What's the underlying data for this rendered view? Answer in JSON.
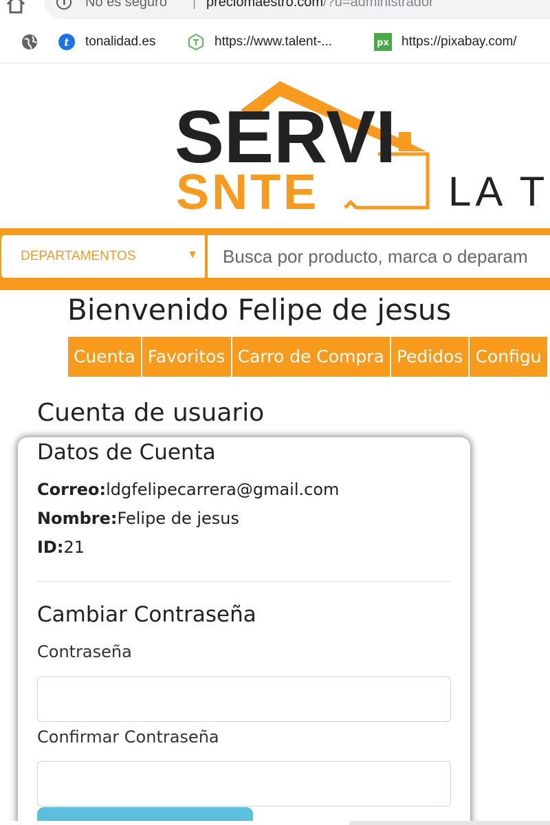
{
  "browser": {
    "security_label": "No es seguro",
    "url_host": "preciomaestro.com",
    "url_path": "/?u=administrador",
    "bookmarks": [
      {
        "label": "tonalidad.es",
        "icon": "tonalidad-favicon"
      },
      {
        "label": "https://www.talent-...",
        "icon": "talent-favicon"
      },
      {
        "label": "https://pixabay.com/",
        "icon": "pixabay-favicon"
      }
    ]
  },
  "header": {
    "logo_text_top": "SERVI",
    "logo_text_bottom": "SNTE",
    "tagline": "LA T",
    "departments_label": "DEPARTAMENTOS",
    "search_placeholder": "Busca por producto, marca o deparam",
    "colors": {
      "accent": "#f89a1c",
      "button": "#5bc0de"
    }
  },
  "welcome": "Bienvenido Felipe de jesus",
  "tabs": [
    {
      "label": "Cuenta"
    },
    {
      "label": "Favoritos"
    },
    {
      "label": "Carro de Compra"
    },
    {
      "label": "Pedidos"
    },
    {
      "label": "Configu"
    }
  ],
  "account": {
    "section_title": "Cuenta de usuario",
    "card_title": "Datos de Cuenta",
    "email_label": "Correo:",
    "email_value": "ldgfelipecarrera@gmail.com",
    "name_label": "Nombre:",
    "name_value": "Felipe de jesus",
    "id_label": "ID:",
    "id_value": "21"
  },
  "password": {
    "title": "Cambiar Contraseña",
    "password_label": "Contraseña",
    "confirm_label": "Confirmar Contraseña",
    "password_value": "",
    "confirm_value": ""
  }
}
